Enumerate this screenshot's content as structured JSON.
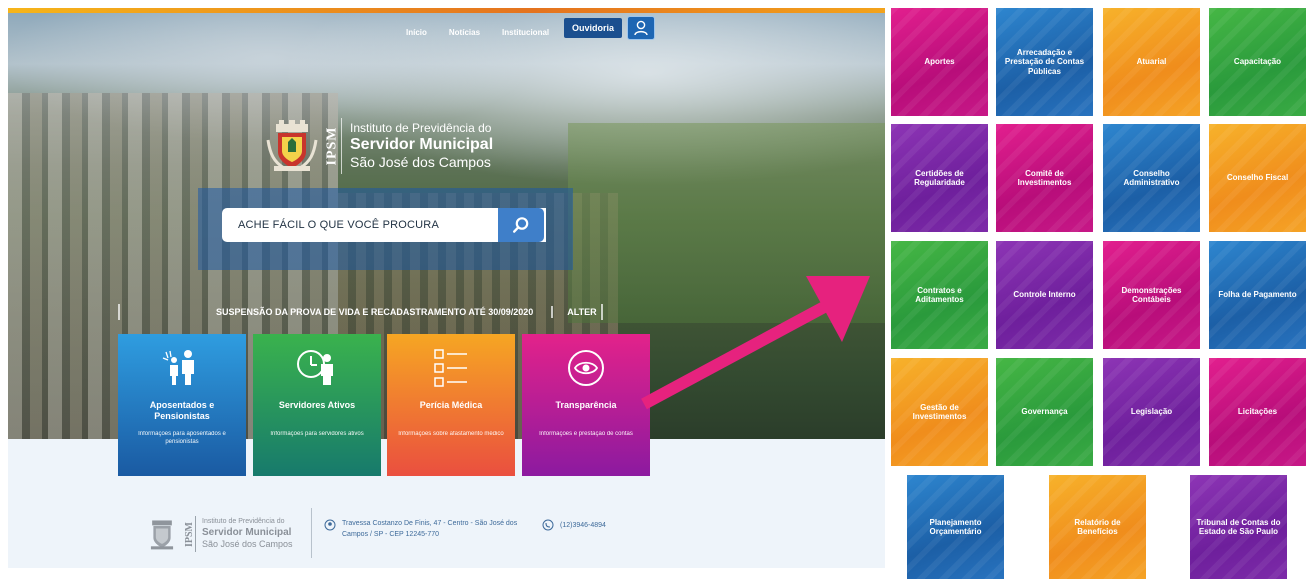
{
  "nav": {
    "items": [
      "Início",
      "Notícias",
      "Institucional"
    ],
    "ouvidoria": "Ouvidoria"
  },
  "brand": {
    "abbr": "IPSM",
    "line1": "Instituto de Previdência do",
    "line2": "Servidor Municipal",
    "line3": "São José dos Campos"
  },
  "search": {
    "placeholder": "ACHE FÁCIL O QUE VOCÊ PROCURA"
  },
  "ticker": {
    "text": "SUSPENSÃO DA PROVA DE VIDA E RECADASTRAMENTO ATÉ 30/09/2020",
    "alter": "ALTER"
  },
  "cards": [
    {
      "title": "Aposentados e Pensionistas",
      "desc": "Informações para aposentados e pensionistas",
      "icon": "retirees-icon"
    },
    {
      "title": "Servidores Ativos",
      "desc": "Informações para servidores ativos",
      "icon": "active-servers-icon"
    },
    {
      "title": "Perícia Médica",
      "desc": "Informações sobre afastamento médico",
      "icon": "medical-list-icon"
    },
    {
      "title": "Transparência",
      "desc": "Informações e prestação de contas",
      "icon": "eye-icon"
    }
  ],
  "footer": {
    "abbr": "IPSM",
    "line1": "Instituto de Previdência do",
    "line2": "Servidor Municipal",
    "line3": "São José dos Campos",
    "address": "Travessa Costanzo De Finis, 47 - Centro - São José dos Campos / SP - CEP 12245-770",
    "phone": "(12)3946-4894"
  },
  "tiles": [
    {
      "label": "Aportes",
      "color": "magenta"
    },
    {
      "label": "Arrecadação e Prestação de Contas Públicas",
      "color": "blue"
    },
    {
      "label": "Atuarial",
      "color": "orange"
    },
    {
      "label": "Capacitação",
      "color": "green"
    },
    {
      "label": "Certidões de Regularidade",
      "color": "purple"
    },
    {
      "label": "Comitê de Investimentos",
      "color": "magenta"
    },
    {
      "label": "Conselho Administrativo",
      "color": "blue"
    },
    {
      "label": "Conselho Fiscal",
      "color": "orange"
    },
    {
      "label": "Contratos e Aditamentos",
      "color": "green"
    },
    {
      "label": "Controle Interno",
      "color": "purple"
    },
    {
      "label": "Demonstrações Contábeis",
      "color": "magenta"
    },
    {
      "label": "Folha de Pagamento",
      "color": "blue"
    },
    {
      "label": "Gestão de Investimentos",
      "color": "orange"
    },
    {
      "label": "Governança",
      "color": "green"
    },
    {
      "label": "Legislação",
      "color": "purple"
    },
    {
      "label": "Licitações",
      "color": "magenta"
    },
    {
      "label": "Planejamento Orçamentário",
      "color": "blue"
    },
    {
      "label": "Relatório de Benefícios",
      "color": "orange"
    },
    {
      "label": "Tribunal de Contas do Estado de São Paulo",
      "color": "purple"
    }
  ],
  "colors": {
    "magenta": "#c71887",
    "blue": "#2873bf",
    "orange": "#f5a326",
    "green": "#3aab44",
    "purple": "#7d2ba9",
    "arrow": "#e6227e"
  }
}
